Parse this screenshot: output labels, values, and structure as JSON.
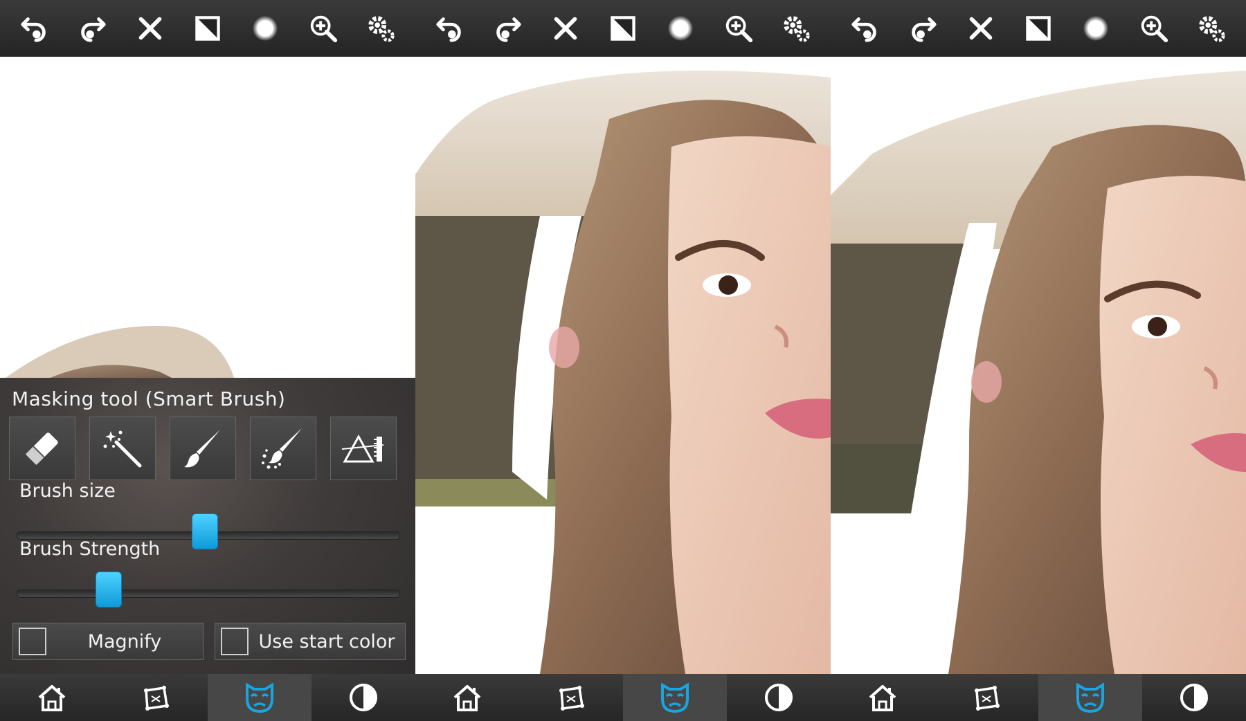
{
  "panel": {
    "title": "Masking tool (Smart Brush)",
    "brush_size_label": "Brush size",
    "brush_size_value": 0.49,
    "brush_strength_label": "Brush Strength",
    "brush_strength_value": 0.22,
    "magnify_label": "Magnify",
    "magnify_checked": false,
    "use_start_color_label": "Use start color",
    "use_start_color_checked": false,
    "tools": [
      "eraser-icon",
      "magic-wand-icon",
      "brush-icon",
      "smart-brush-icon",
      "gradient-icon"
    ],
    "active_tool": "smart-brush-icon"
  },
  "topbar_icons": [
    "undo-icon",
    "redo-icon",
    "close-icon",
    "invert-mask-icon",
    "brush-shape-icon",
    "zoom-in-icon",
    "settings-icon"
  ],
  "bottombar_icons": [
    "home-icon",
    "transform-icon",
    "mask-icon",
    "adjust-icon"
  ],
  "active_bottom": "mask-icon",
  "colors": {
    "accent": "#1aa4e0",
    "topbar": "#2a2a2a",
    "panel": "#3f3b3a"
  }
}
